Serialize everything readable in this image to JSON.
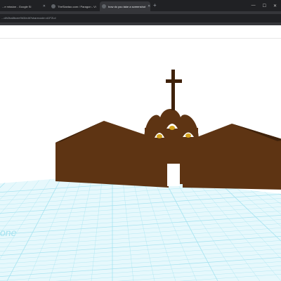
{
  "browser": {
    "tabs": [
      {
        "label": "...e mission - Google Sl"
      },
      {
        "label": "TheSlantao.com / Paragon - Vi"
      },
      {
        "label": "how do you take a screenshot"
      }
    ],
    "new_tab": "+",
    "url": "...d/b2ba8bcee9b3/edit?sharecode=d1F2Ld"
  },
  "workplane": {
    "label": "one"
  },
  "colors": {
    "model": "#5e3413",
    "model_dark": "#3f220b",
    "bell": "#d4a21a",
    "grid": "#a6e3f0",
    "grid_bg": "#e6f8fc"
  }
}
